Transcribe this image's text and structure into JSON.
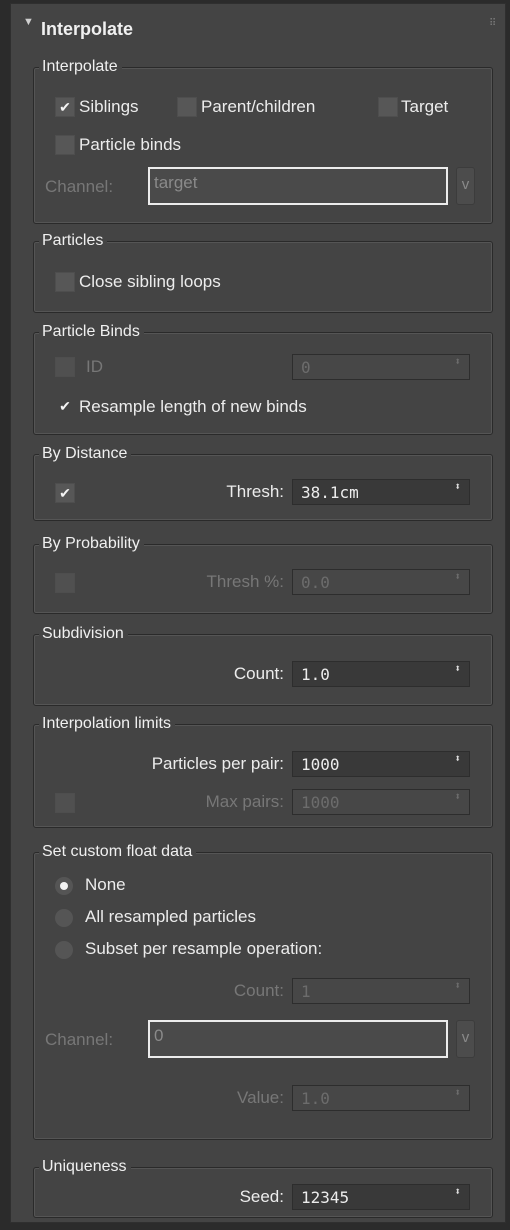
{
  "panel": {
    "title": "Interpolate",
    "collapse_icon": "triangle-down-icon",
    "grip_icon": "grip-dots-icon"
  },
  "interpolate_group": {
    "title": "Interpolate",
    "siblings": {
      "label": "Siblings",
      "checked": true
    },
    "parent_children": {
      "label": "Parent/children",
      "checked": false
    },
    "target": {
      "label": "Target",
      "checked": false
    },
    "particle_binds": {
      "label": "Particle binds",
      "checked": false
    },
    "channel_label": "Channel:",
    "channel_value": "target",
    "channel_button": "v"
  },
  "particles_group": {
    "title": "Particles",
    "close_sibling_loops": {
      "label": "Close sibling loops",
      "checked": false
    }
  },
  "particle_binds_group": {
    "title": "Particle Binds",
    "id": {
      "label": "ID",
      "checked": false,
      "value": "0"
    },
    "resample_length": {
      "label": "Resample length of new binds",
      "checked": true
    }
  },
  "by_distance_group": {
    "title": "By Distance",
    "enabled": true,
    "thresh_label": "Thresh:",
    "thresh_value": "38.1cm"
  },
  "by_probability_group": {
    "title": "By Probability",
    "enabled": false,
    "thresh_label": "Thresh %:",
    "thresh_value": "0.0"
  },
  "subdivision_group": {
    "title": "Subdivision",
    "count_label": "Count:",
    "count_value": "1.0"
  },
  "interpolation_limits_group": {
    "title": "Interpolation limits",
    "particles_per_pair_label": "Particles per pair:",
    "particles_per_pair_value": "1000",
    "max_pairs_enabled": false,
    "max_pairs_label": "Max pairs:",
    "max_pairs_value": "1000"
  },
  "custom_float_group": {
    "title": "Set custom float data",
    "options": [
      "None",
      "All resampled particles",
      "Subset per resample operation:"
    ],
    "selected": "None",
    "count_label": "Count:",
    "count_value": "1",
    "channel_label": "Channel:",
    "channel_value": "0",
    "channel_button": "v",
    "value_label": "Value:",
    "value_value": "1.0"
  },
  "uniqueness_group": {
    "title": "Uniqueness",
    "seed_label": "Seed:",
    "seed_value": "12345"
  },
  "spinner_arrow": "⬍",
  "check_mark": "✔"
}
